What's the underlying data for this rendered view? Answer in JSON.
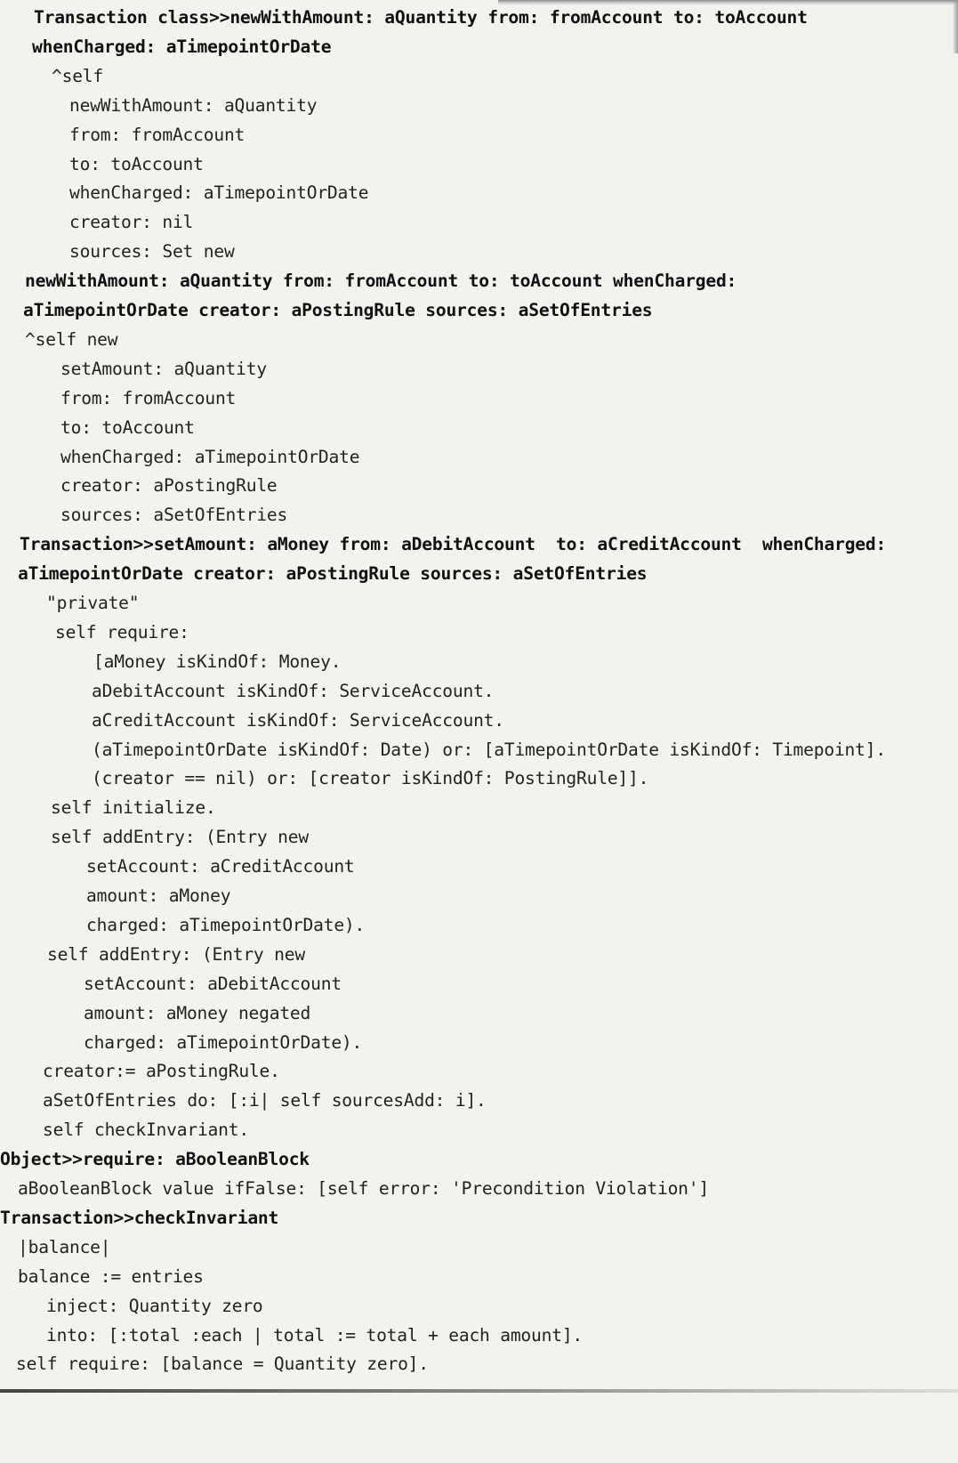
{
  "lines": [
    "Transaction class>>newWithAmount: aQuantity from: fromAccount to: toAccount",
    "whenCharged: aTimepointOrDate",
    "^self",
    "newWithAmount: aQuantity",
    "from: fromAccount",
    "to: toAccount",
    "whenCharged: aTimepointOrDate",
    "creator: nil",
    "sources: Set new",
    "newWithAmount: aQuantity from: fromAccount to: toAccount whenCharged:",
    "aTimepointOrDate creator: aPostingRule sources: aSetOfEntries",
    "^self new",
    "setAmount: aQuantity",
    "from: fromAccount",
    "to: toAccount",
    "whenCharged: aTimepointOrDate",
    "creator: aPostingRule",
    "sources: aSetOfEntries",
    "Transaction>>setAmount: aMoney from: aDebitAccount  to: aCreditAccount  whenCharged:",
    "aTimepointOrDate creator: aPostingRule sources: aSetOfEntries",
    "\"private\"",
    "self require:",
    "[aMoney isKindOf: Money.",
    "aDebitAccount isKindOf: ServiceAccount.",
    "aCreditAccount isKindOf: ServiceAccount.",
    "(aTimepointOrDate isKindOf: Date) or: [aTimepointOrDate isKindOf: Timepoint].",
    "(creator == nil) or: [creator isKindOf: PostingRule]].",
    "self initialize.",
    "self addEntry: (Entry new",
    "setAccount: aCreditAccount",
    "amount: aMoney",
    "charged: aTimepointOrDate).",
    "self addEntry: (Entry new",
    "setAccount: aDebitAccount",
    "amount: aMoney negated",
    "charged: aTimepointOrDate).",
    "creator:= aPostingRule.",
    "aSetOfEntries do: [:i| self sourcesAdd: i].",
    "self checkInvariant.",
    "Object>>require: aBooleanBlock",
    "aBooleanBlock value ifFalse: [self error: 'Precondition Violation']",
    "Transaction>>checkInvariant",
    "|balance|",
    "balance := entries",
    "inject: Quantity zero",
    "into: [:total :each | total := total + each amount].",
    "self require: [balance = Quantity zero]."
  ]
}
